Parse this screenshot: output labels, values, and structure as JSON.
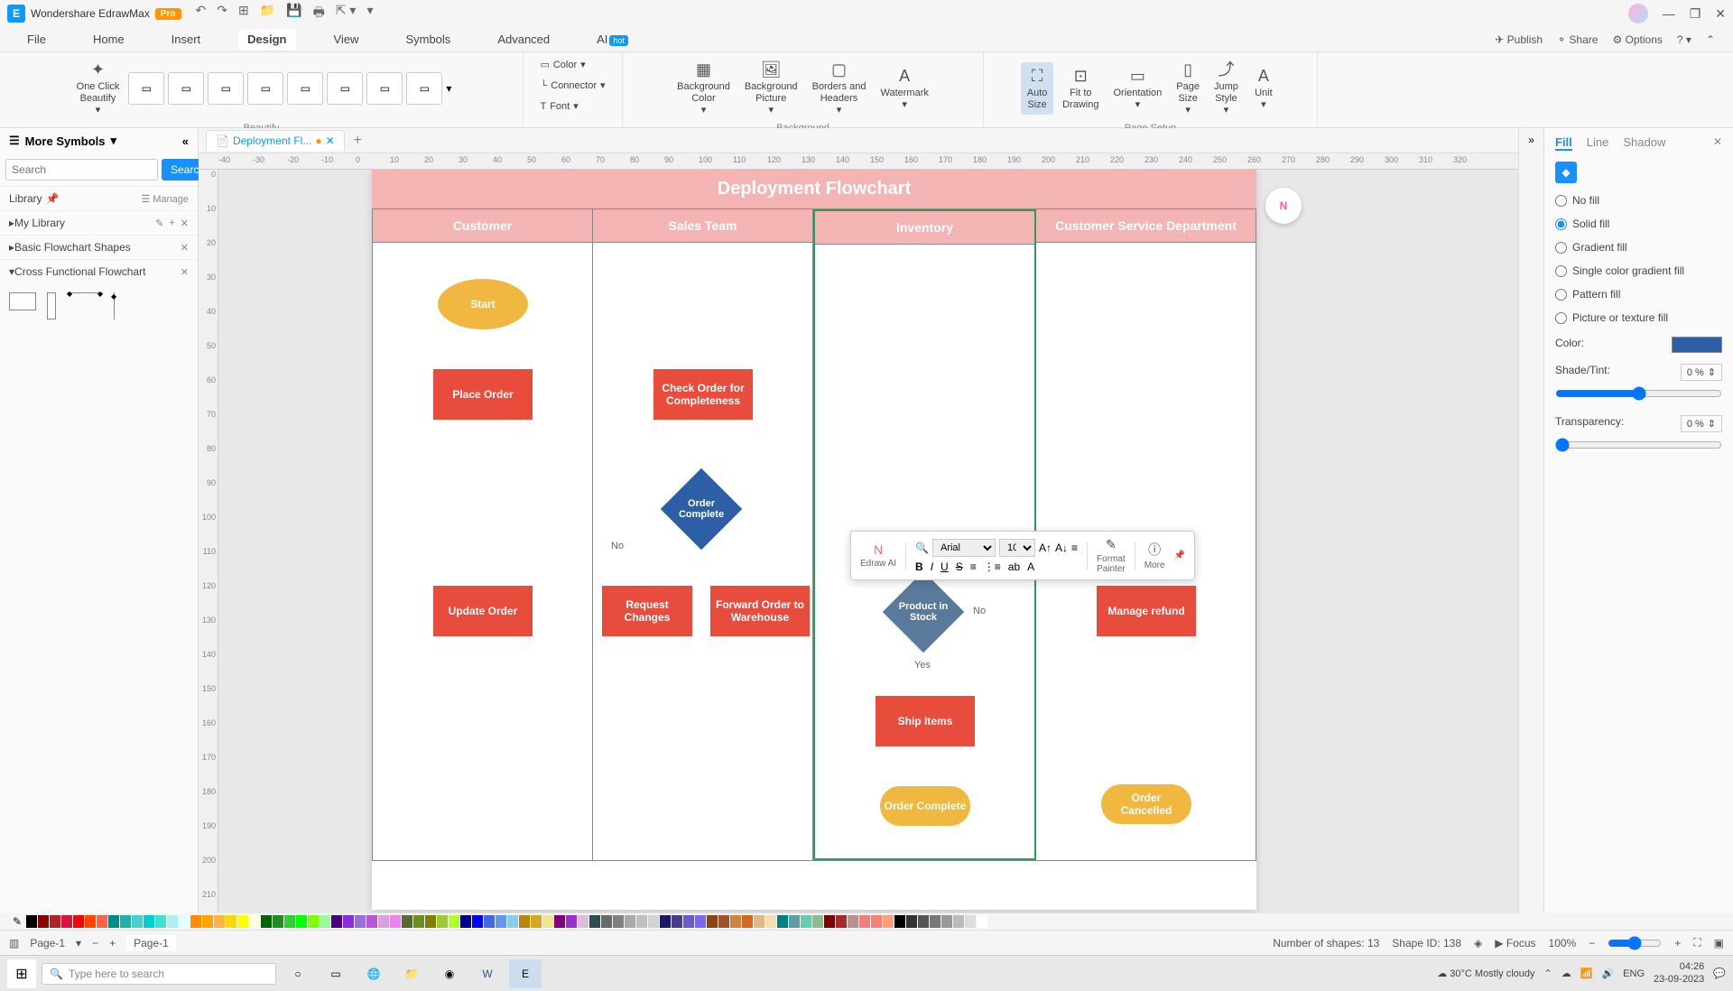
{
  "titlebar": {
    "app": "Wondershare EdrawMax",
    "pro": "Pro"
  },
  "menus": {
    "file": "File",
    "home": "Home",
    "insert": "Insert",
    "design": "Design",
    "view": "View",
    "symbols": "Symbols",
    "advanced": "Advanced",
    "ai": "AI",
    "hot": "hot",
    "publish": "Publish",
    "share": "Share",
    "options": "Options"
  },
  "ribbon": {
    "oneclick": "One Click\nBeautify",
    "beautify": "Beautify",
    "color": "Color",
    "connector": "Connector",
    "font": "Font",
    "bg_color": "Background\nColor",
    "bg_pic": "Background\nPicture",
    "borders": "Borders and\nHeaders",
    "watermark": "Watermark",
    "background": "Background",
    "autosize": "Auto\nSize",
    "fit": "Fit to\nDrawing",
    "orient": "Orientation",
    "pagesize": "Page\nSize",
    "jump": "Jump\nStyle",
    "unit": "Unit",
    "pagesetup": "Page Setup"
  },
  "tab_name": "Deployment Fl...",
  "left": {
    "header": "More Symbols",
    "search_ph": "Search",
    "search_btn": "Search",
    "library": "Library",
    "manage": "Manage",
    "mylib": "My Library",
    "basic": "Basic Flowchart Shapes",
    "cross": "Cross Functional Flowchart"
  },
  "flowchart": {
    "title": "Deployment Flowchart",
    "lanes": [
      "Customer",
      "Sales Team",
      "Inventory",
      "Customer Service Department"
    ],
    "start": "Start",
    "place": "Place Order",
    "check": "Check Order for Completeness",
    "complete": "Order Complete",
    "update": "Update Order",
    "request": "Request Changes",
    "forward": "Forward Order to Warehouse",
    "stock": "Product in Stock",
    "refund": "Manage refund",
    "ship": "Ship Items",
    "ocomplete": "Order Complete",
    "cancelled": "Order Cancelled",
    "no": "No",
    "yes": "Yes"
  },
  "float": {
    "ai": "Edraw AI",
    "font": "Arial",
    "size": "10",
    "painter": "Format\nPainter",
    "more": "More"
  },
  "right": {
    "fill": "Fill",
    "line": "Line",
    "shadow": "Shadow",
    "nofill": "No fill",
    "solid": "Solid fill",
    "gradient": "Gradient fill",
    "single": "Single color gradient fill",
    "pattern": "Pattern fill",
    "picture": "Picture or texture fill",
    "color": "Color:",
    "shade": "Shade/Tint:",
    "trans": "Transparency:",
    "zero": "0 %"
  },
  "status": {
    "page": "Page-1",
    "page2": "Page-1",
    "shapes": "Number of shapes: 13",
    "id": "Shape ID: 138",
    "focus": "Focus",
    "zoom": "100%"
  },
  "taskbar": {
    "search": "Type here to search",
    "weather": "30°C  Mostly cloudy",
    "time": "04:26",
    "date": "23-09-2023"
  }
}
